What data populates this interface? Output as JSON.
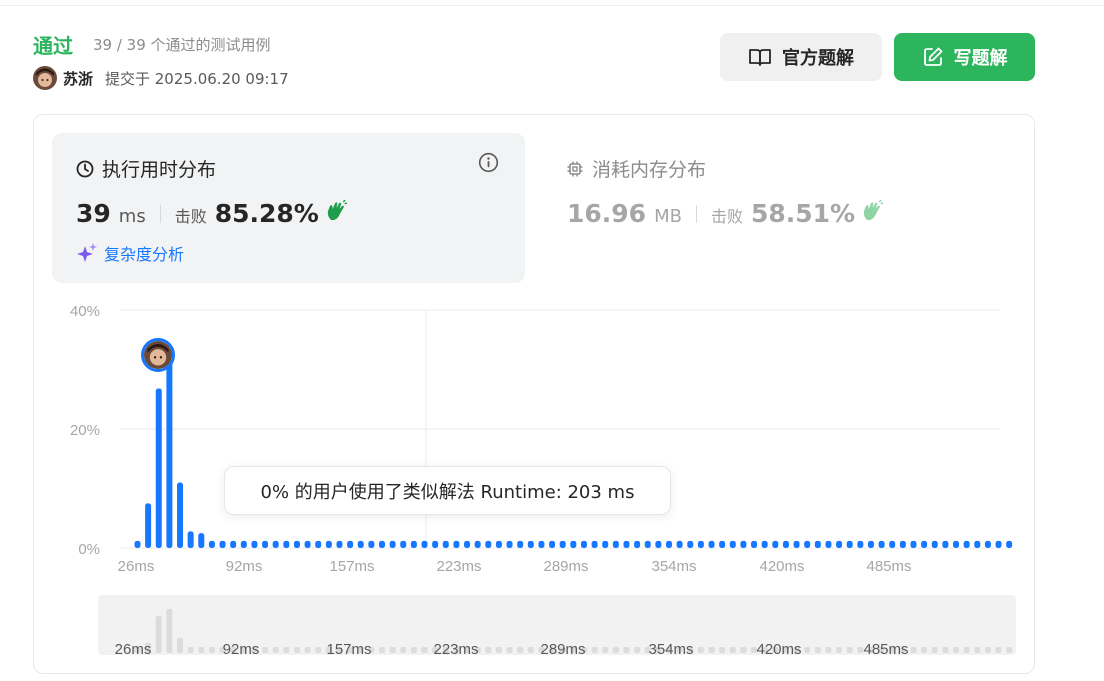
{
  "header": {
    "status": "通过",
    "cases": "39 / 39 个通过的测试用例",
    "author": "苏浙",
    "submitted": "提交于 2025.06.20 09:17"
  },
  "buttons": {
    "official": "官方题解",
    "write": "写题解"
  },
  "runtime_panel": {
    "title": "执行用时分布",
    "value": "39",
    "unit": "ms",
    "beat_label": "击败",
    "beat_pct": "85.28%",
    "complexity": "复杂度分析"
  },
  "memory_panel": {
    "title": "消耗内存分布",
    "value": "16.96",
    "unit": "MB",
    "beat_label": "击败",
    "beat_pct": "58.51%"
  },
  "tooltip": "0% 的用户使用了类似解法 Runtime: 203 ms",
  "colors": {
    "accent_green": "#2db55d",
    "bar_blue": "#1677ff",
    "nav_bar": "#dcdcdc"
  },
  "chart_data": {
    "type": "bar",
    "ylim": [
      0,
      40
    ],
    "y_ticks": [
      "0%",
      "20%",
      "40%"
    ],
    "x_tick_labels": [
      "26ms",
      "92ms",
      "157ms",
      "223ms",
      "289ms",
      "354ms",
      "420ms",
      "485ms"
    ],
    "user_runtime": "39ms",
    "values": [
      1.2,
      7.5,
      26.8,
      32.0,
      11.0,
      2.8,
      2.5,
      1.2,
      1.2,
      1.2,
      1.2,
      1.2,
      1.2,
      1.2,
      1.2,
      1.2,
      1.2,
      1.2,
      1.2,
      1.2,
      1.2,
      1.2,
      1.2,
      1.2,
      1.2,
      1.2,
      1.2,
      1.2,
      1.2,
      1.2,
      1.2,
      1.2,
      1.2,
      1.2,
      1.2,
      1.2,
      1.2,
      1.2,
      1.2,
      1.2,
      1.2,
      1.2,
      1.2,
      1.2,
      1.2,
      1.2,
      1.2,
      1.2,
      1.2,
      1.2,
      1.2,
      1.2,
      1.2,
      1.2,
      1.2,
      1.2,
      1.2,
      1.2,
      1.2,
      1.2,
      1.2,
      1.2,
      1.2,
      1.2,
      1.2,
      1.2,
      1.2,
      1.2,
      1.2,
      1.2,
      1.2,
      1.2,
      1.2,
      1.2,
      1.2,
      1.2,
      1.2,
      1.2,
      1.2,
      1.2,
      1.2,
      1.2,
      1.2
    ]
  }
}
